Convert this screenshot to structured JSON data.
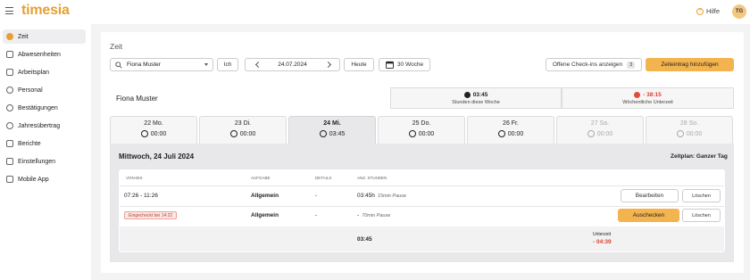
{
  "app": {
    "logo": "timesia",
    "help_label": "Hilfe",
    "avatar_initials": "TG",
    "accent": "#f3b34f"
  },
  "sidebar": {
    "items": [
      {
        "label": "Zeit",
        "icon": "clock-icon",
        "active": true
      },
      {
        "label": "Abwesenheiten",
        "icon": "calendar-icon"
      },
      {
        "label": "Arbeitsplan",
        "icon": "clipboard-icon"
      },
      {
        "label": "Personal",
        "icon": "people-icon"
      },
      {
        "label": "Bestätigungen",
        "icon": "check-circle-icon"
      },
      {
        "label": "Jahresübertrag",
        "icon": "arrow-right-circle-icon"
      },
      {
        "label": "Berichte",
        "icon": "folder-icon"
      },
      {
        "label": "Einstellungen",
        "icon": "sliders-icon"
      },
      {
        "label": "Mobile App",
        "icon": "phone-icon"
      }
    ]
  },
  "page": {
    "title": "Zeit"
  },
  "toolbar": {
    "employee_value": "Fiona Muster",
    "me_button": "Ich",
    "date": "24.07.2024",
    "today_button": "Heute",
    "view_select": "30 Woche",
    "open_checkins": "Offene Check-ins anzeigen",
    "open_checkins_count": "3",
    "add_entry": "Zeiteintrag hinzufügen"
  },
  "summary": {
    "name": "Fiona Muster",
    "hours_value": "03:45",
    "hours_label": "Stunden diese Woche",
    "under_value": "- 38:15",
    "under_label": "Wöchentliche Unterzeit"
  },
  "days": [
    {
      "label": "22 Mo.",
      "time": "00:00"
    },
    {
      "label": "23 Di.",
      "time": "00:00"
    },
    {
      "label": "24 Mi.",
      "time": "03:45"
    },
    {
      "label": "25 Do.",
      "time": "00:00"
    },
    {
      "label": "26 Fr.",
      "time": "00:00"
    },
    {
      "label": "27 Sa.",
      "time": "00:00"
    },
    {
      "label": "28 So.",
      "time": "00:00"
    }
  ],
  "detail": {
    "date_title": "Mittwoch, 24 Juli 2024",
    "plan": "Zeitplan: Ganzer Tag",
    "headers": {
      "time": "VON-BIS",
      "task": "AUFGABE",
      "details": "DETAILS",
      "hours": "ANZ. STUNDEN"
    },
    "rows": [
      {
        "time": "07:26 - 11:26",
        "task": "Allgemein",
        "details": "-",
        "hours": "03:45h",
        "pause": "15min Pause",
        "action": "Bearbeiten",
        "delete": "Löschen"
      },
      {
        "checked_in": "Eingecheckt bei 14:22",
        "task": "Allgemein",
        "details": "-",
        "hours": "-",
        "pause": "70min Pause",
        "action": "Auschecken",
        "delete": "Löschen"
      }
    ],
    "total_hours": "03:45",
    "under_label": "Unterzeit",
    "under_value": "- 04:39"
  }
}
